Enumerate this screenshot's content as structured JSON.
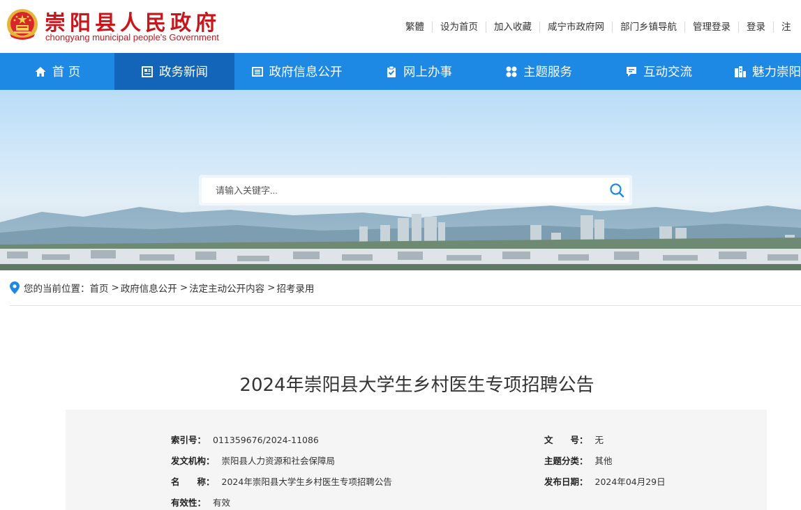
{
  "header": {
    "title_cn": "崇阳县人民政府",
    "title_en": "chongyang municipal people's Government",
    "top_links": [
      "繁體",
      "设为首页",
      "加入收藏",
      "咸宁市政府网",
      "部门乡镇导航",
      "管理登录",
      "登录",
      "注"
    ]
  },
  "nav": {
    "items": [
      {
        "label": "首 页",
        "icon": "home-icon"
      },
      {
        "label": "政务新闻",
        "icon": "newspaper-icon"
      },
      {
        "label": "政府信息公开",
        "icon": "list-icon"
      },
      {
        "label": "网上办事",
        "icon": "clipboard-check-icon"
      },
      {
        "label": "主题服务",
        "icon": "grid-dots-icon"
      },
      {
        "label": "互动交流",
        "icon": "chat-icon"
      },
      {
        "label": "魅力崇阳",
        "icon": "city-icon"
      }
    ],
    "active_index": 1
  },
  "search": {
    "placeholder": "请输入关键字..."
  },
  "breadcrumb": {
    "prefix": "您的当前位置：",
    "items": [
      "首页",
      "政府信息公开",
      "法定主动公开内容",
      "招考录用"
    ],
    "separator": ">"
  },
  "article": {
    "title": "2024年崇阳县大学生乡村医生专项招聘公告",
    "meta": {
      "index_label": "索引号：",
      "index_value": "011359676/2024-11086",
      "doc_no_label": "文　　号：",
      "doc_no_value": "无",
      "issuer_label": "发文机构：",
      "issuer_value": "崇阳县人力资源和社会保障局",
      "topic_label": "主题分类：",
      "topic_value": "其他",
      "name_label": "名　　称：",
      "name_value": "2024年崇阳县大学生乡村医生专项招聘公告",
      "date_label": "发布日期：",
      "date_value": "2024年04月29日",
      "validity_label": "有效性：",
      "validity_value": "有效"
    }
  },
  "colors": {
    "brand_red": "#c8161d",
    "nav_blue": "#1e88e5",
    "nav_active": "#1265b8"
  }
}
